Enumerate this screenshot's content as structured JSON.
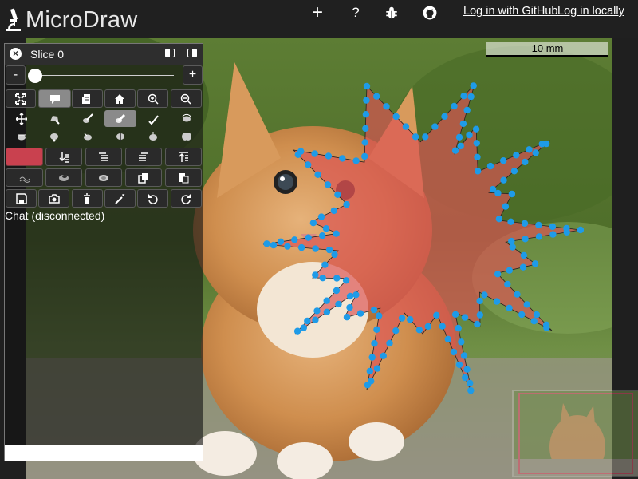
{
  "app": {
    "title": "MicroDraw",
    "login_github": "Log in with GitHub",
    "login_local": "Log in locally",
    "top_icons": [
      "plus-icon",
      "help-icon",
      "bug-icon",
      "github-icon"
    ],
    "help_glyph": "?",
    "plus_glyph": "+"
  },
  "panel": {
    "slice_title": "Slice 0",
    "slider_minus": "-",
    "slider_plus": "+",
    "slider_value": 0.0,
    "chat_label": "Chat (disconnected)",
    "tool_rows": [
      [
        "fullscreen-icon",
        "chat-icon",
        "notes-icon",
        "home-icon",
        "zoom-in-icon",
        "zoom-out-icon"
      ],
      [
        "move-tool-icon",
        "draw-polygon-icon",
        "draw-icon",
        "erase-icon",
        "checkmark-icon",
        "rotate-icon"
      ],
      [
        "select-icon",
        "add-point-icon",
        "delete-point-icon",
        "split-icon",
        "flip-icon",
        "union-icon"
      ],
      [
        "color-swatch",
        "send-to-back-icon",
        "send-backward-icon",
        "bring-forward-icon",
        "bring-to-front-icon"
      ],
      [
        "simplify-icon",
        "subtract-icon",
        "intersect-icon",
        "copy-icon",
        "paste-icon"
      ],
      [
        "save-icon",
        "screenshot-icon",
        "delete-icon",
        "magic-wand-icon",
        "undo-icon",
        "redo-icon"
      ]
    ],
    "selected_tools": [
      "chat-icon",
      "erase-icon"
    ],
    "region_color": "#c9414f"
  },
  "viewer": {
    "scalebar_label": "10 mm",
    "region_fill": "#dc5454",
    "point_color": "#1e9be8"
  }
}
